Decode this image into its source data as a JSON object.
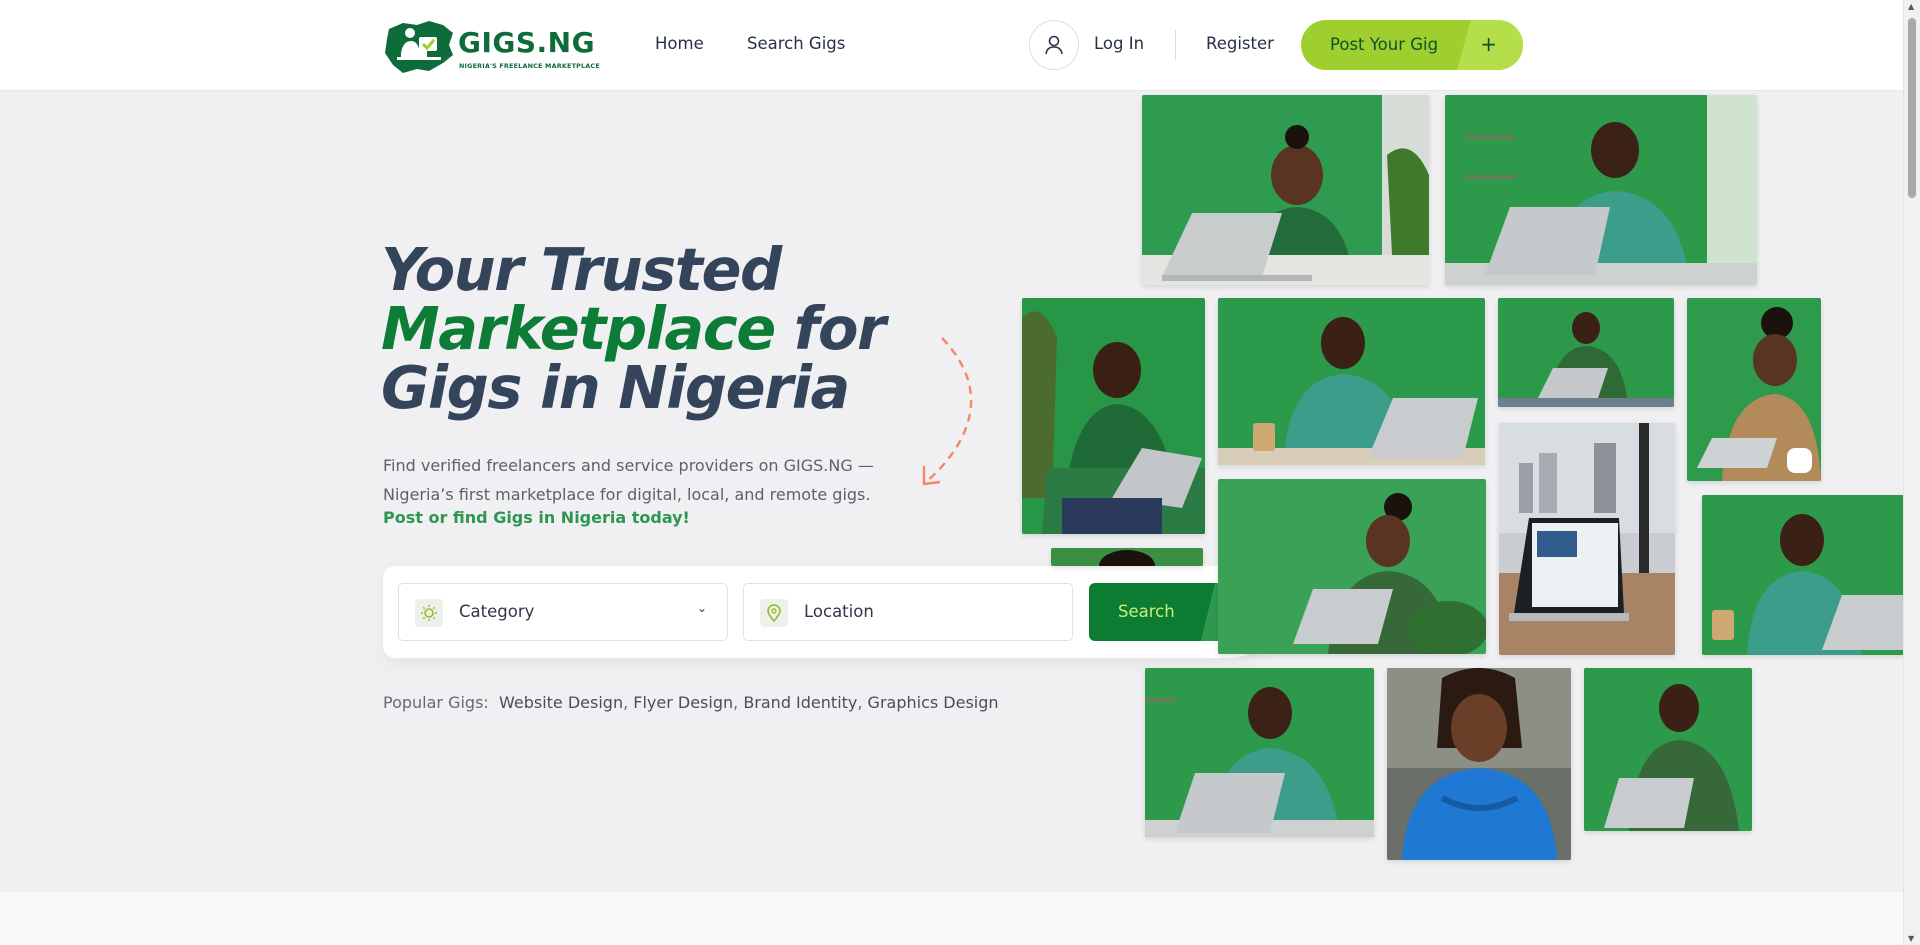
{
  "brand": {
    "name": "GIGS.NG",
    "tagline": "NIGERIA'S FREELANCE MARKETPLACE",
    "primary_color": "#0c7c36",
    "accent_color": "#9fcf2e"
  },
  "header": {
    "nav": [
      {
        "label": "Home"
      },
      {
        "label": "Search Gigs"
      }
    ],
    "user_icon": "user-icon",
    "login_label": "Log In",
    "register_label": "Register",
    "post_gig_label": "Post Your Gig",
    "post_gig_icon": "+"
  },
  "hero": {
    "title_line1": "Your Trusted",
    "title_highlight": "Marketplace",
    "title_line2_rest": " for",
    "title_line3": "Gigs in Nigeria",
    "description": "Find verified freelancers and service providers on GIGS.NG — Nigeria’s first marketplace for digital, local, and remote gigs.",
    "cta": "Post or find Gigs in Nigeria today!"
  },
  "search": {
    "category_label": "Category",
    "category_icon": "lightbulb-icon",
    "location_label": "Location",
    "location_icon": "map-pin-icon",
    "button_label": "Search",
    "button_icon": "search-icon"
  },
  "popular": {
    "label": "Popular Gigs:",
    "items": [
      "Website Design",
      "Flyer Design",
      "Brand Identity",
      "Graphics Design"
    ]
  }
}
